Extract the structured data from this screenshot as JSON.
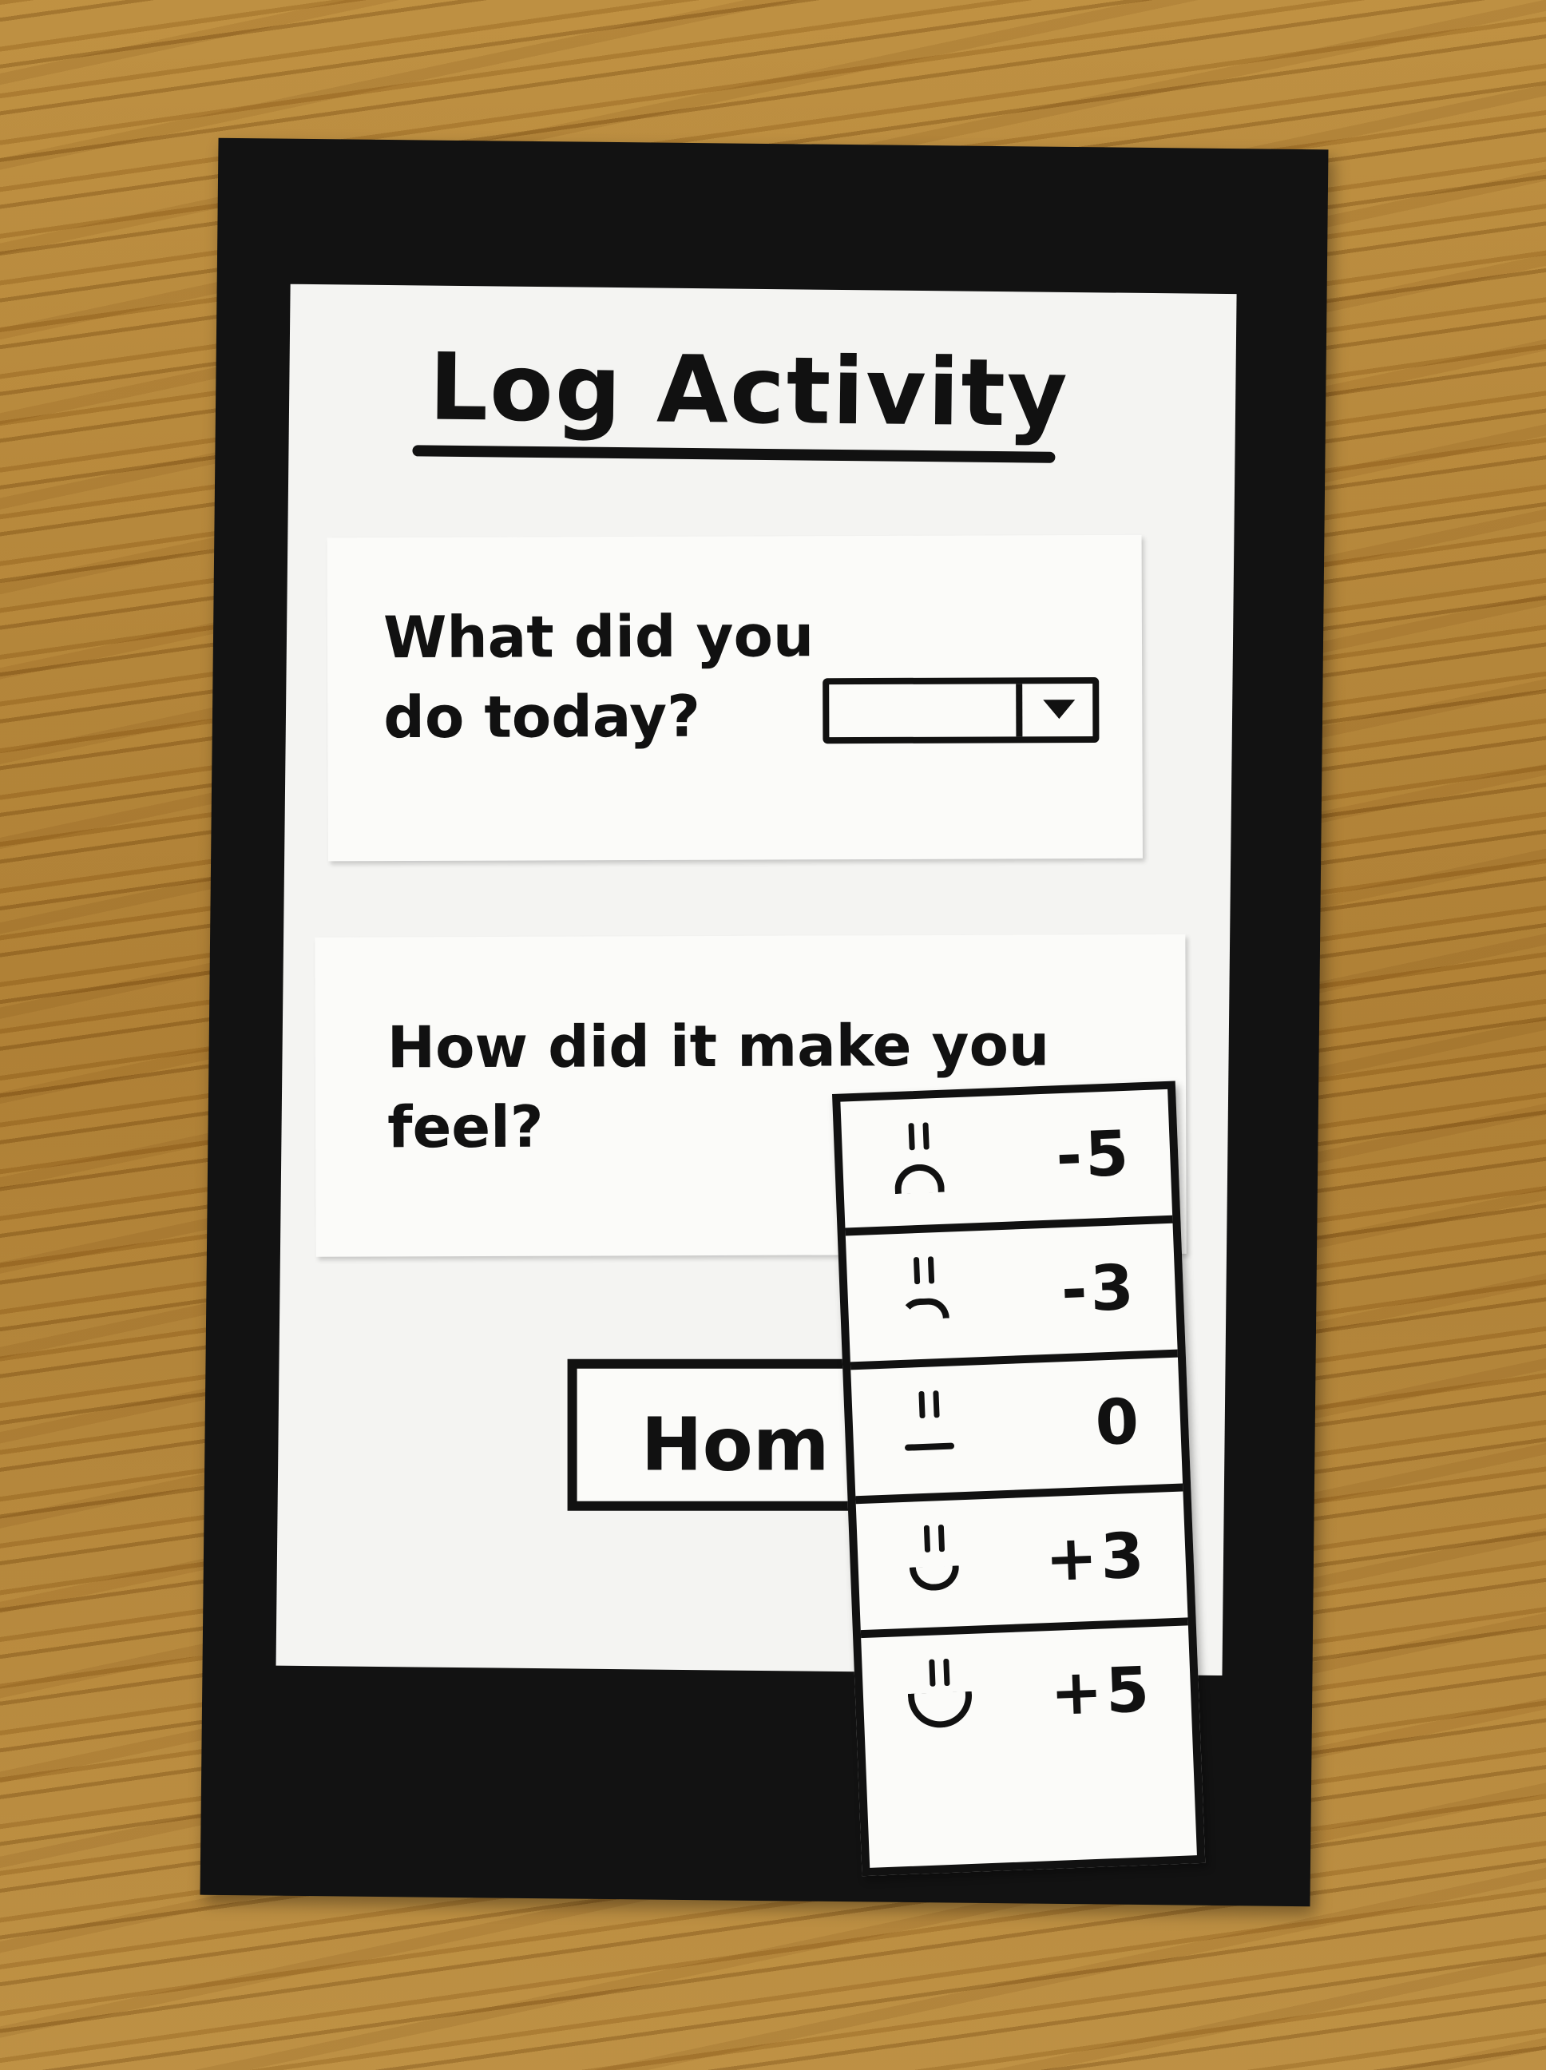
{
  "screen": {
    "title": "Log Activity"
  },
  "activity_card": {
    "question": "What did you do today?",
    "select_value": ""
  },
  "feel_card": {
    "question": "How did it make you feel?"
  },
  "home_button": {
    "label": "Hom"
  },
  "mood_dropdown": {
    "options": [
      {
        "face": "very-sad-face-icon",
        "value": "-5"
      },
      {
        "face": "sad-face-icon",
        "value": "-3"
      },
      {
        "face": "neutral-face-icon",
        "value": "0"
      },
      {
        "face": "happy-face-icon",
        "value": "+3"
      },
      {
        "face": "very-happy-face-icon",
        "value": "+5"
      }
    ]
  },
  "colors": {
    "ink": "#111111",
    "paper": "#f4f4f2",
    "frame": "#121212",
    "table": "#b98a3c"
  }
}
